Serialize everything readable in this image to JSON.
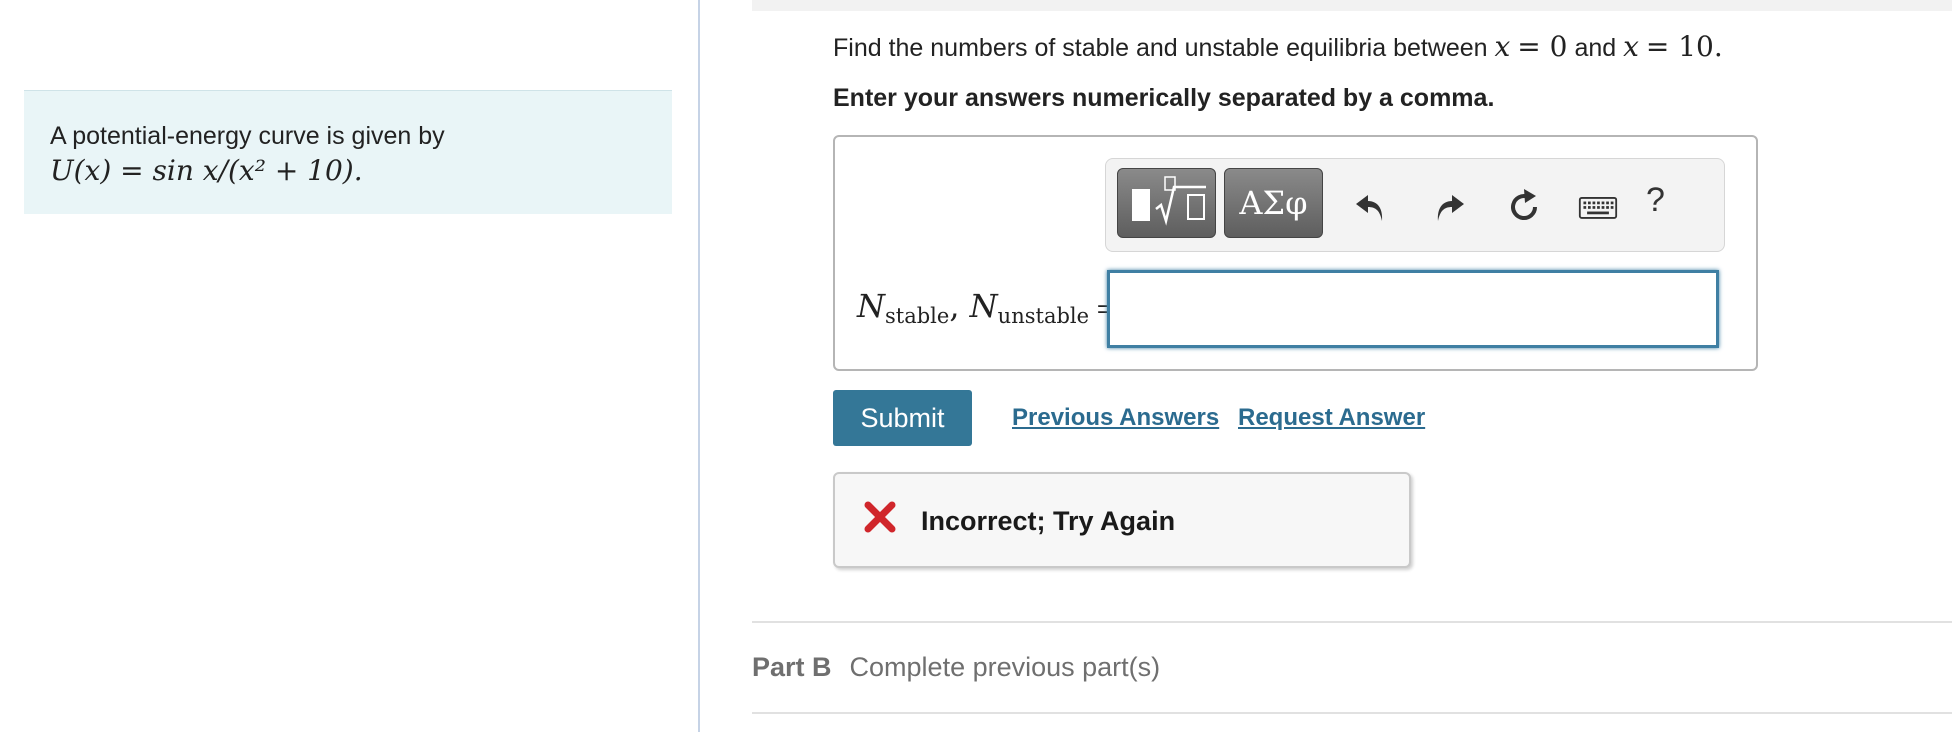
{
  "problem": {
    "intro": "A potential-energy curve is given by",
    "formula": "U(x) = sin x/(x² + 10)."
  },
  "question": {
    "text_prefix": "Find the numbers of stable and unstable equilibria between",
    "var1": "x",
    "eq1": "= 0",
    "and": "and",
    "var2": "x",
    "eq2": "= 10."
  },
  "instruction": "Enter your answers numerically separated by a comma.",
  "toolbar": {
    "symbols_label": "ΑΣφ",
    "help_label": "?",
    "icons": [
      "templates-icon",
      "undo-icon",
      "redo-icon",
      "reset-icon",
      "keyboard-icon",
      "help-icon"
    ]
  },
  "answer": {
    "var": "N",
    "sub1": "stable",
    "sub2": "unstable",
    "comma": ",",
    "equals": "=",
    "value": ""
  },
  "actions": {
    "submit_label": "Submit",
    "previous_answers": "Previous Answers",
    "request_answer": "Request Answer"
  },
  "feedback": {
    "message": "Incorrect; Try Again",
    "color": "#d0262b"
  },
  "part_b": {
    "label": "Part B",
    "status": "Complete previous part(s)"
  },
  "colors": {
    "accent": "#347797",
    "link": "#2b6b8f",
    "panel_bg": "#e9f5f7"
  }
}
